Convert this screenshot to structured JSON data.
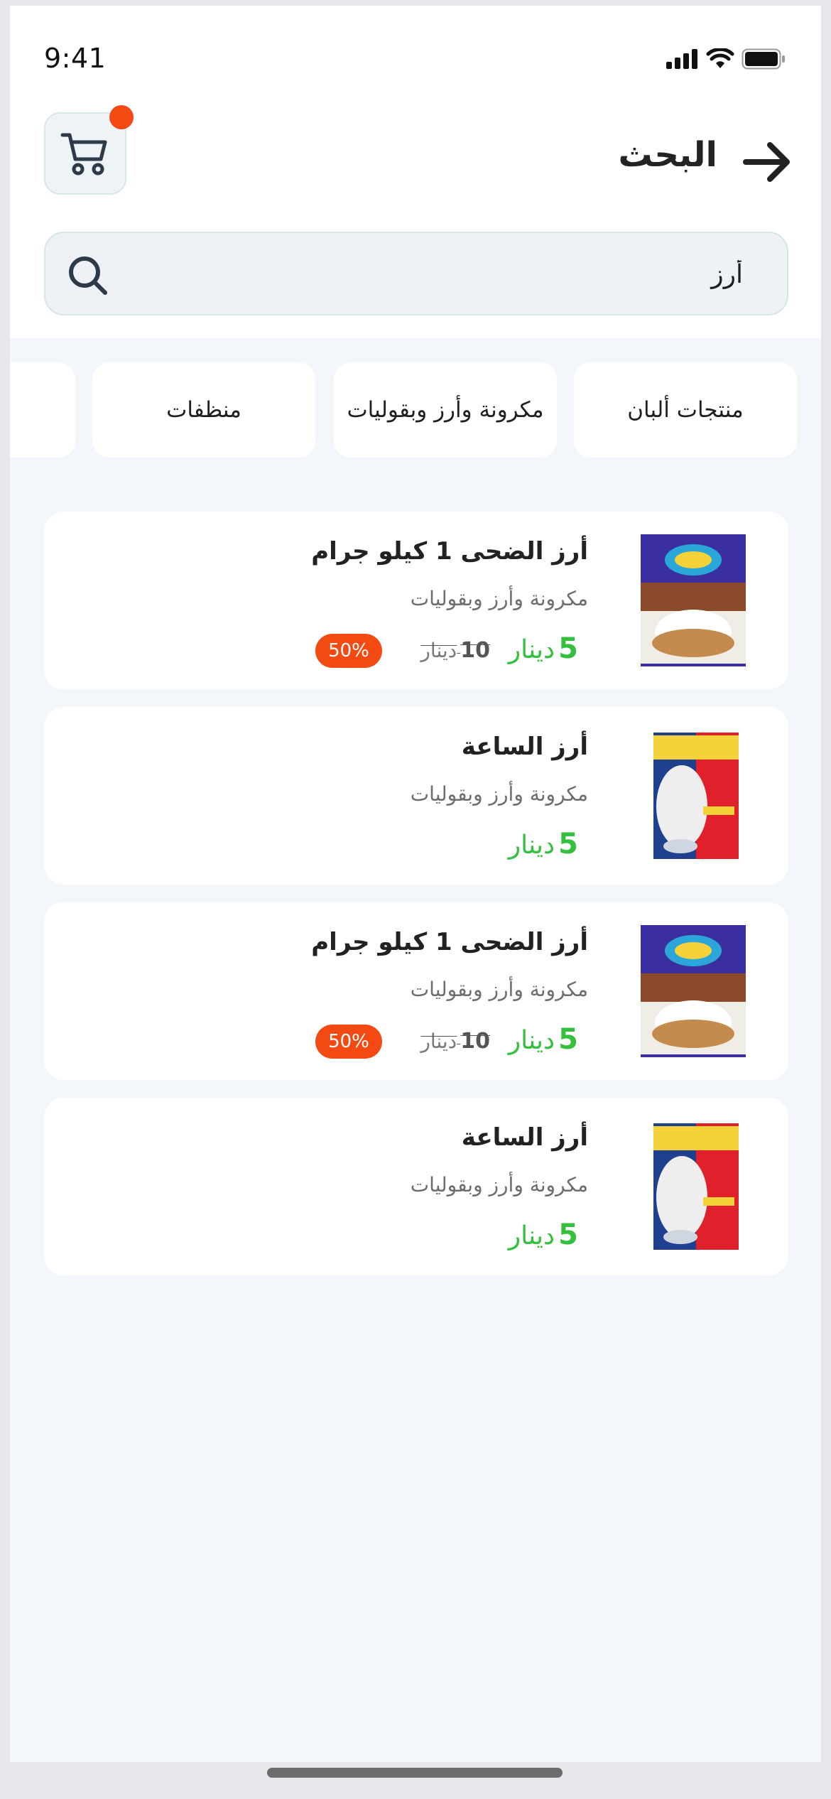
{
  "status_bar": {
    "time": "9:41"
  },
  "header": {
    "title": "البحث"
  },
  "search": {
    "value": "أرز"
  },
  "categories": [
    {
      "label": "منتجات ألبان"
    },
    {
      "label": "مكرونة وأرز وبقوليات"
    },
    {
      "label": "منظفات"
    },
    {
      "label": ""
    }
  ],
  "products": [
    {
      "name": "أرز الضحى 1 كيلو جرام",
      "category": "مكرونة وأرز وبقوليات",
      "price": "5",
      "currency": "دينار",
      "old_price": "10",
      "old_currency": "دينار",
      "discount": "50%",
      "image": "rice-bag-ad-doha"
    },
    {
      "name": "أرز الساعة",
      "category": "مكرونة وأرز وبقوليات",
      "price": "5",
      "currency": "دينار",
      "image": "rice-bag-al-saa"
    },
    {
      "name": "أرز الضحى 1 كيلو جرام",
      "category": "مكرونة وأرز وبقوليات",
      "price": "5",
      "currency": "دينار",
      "old_price": "10",
      "old_currency": "دينار",
      "discount": "50%",
      "image": "rice-bag-ad-doha"
    },
    {
      "name": "أرز الساعة",
      "category": "مكرونة وأرز وبقوليات",
      "price": "5",
      "currency": "دينار",
      "image": "rice-bag-al-saa"
    }
  ],
  "colors": {
    "accent_orange": "#f24a12",
    "price_green": "#34c03e",
    "background": "#f3f6fb"
  }
}
